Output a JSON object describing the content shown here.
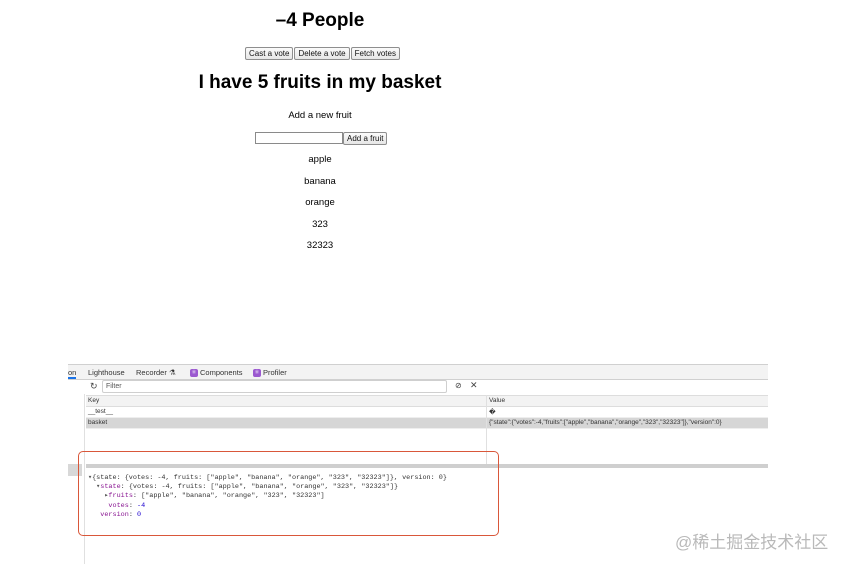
{
  "app": {
    "title": "–4 People",
    "vote_buttons": [
      "Cast a vote",
      "Delete a vote",
      "Fetch votes"
    ],
    "basket_title": "I have 5 fruits in my basket",
    "add_label": "Add a new fruit",
    "fruit_input_value": "",
    "add_button": "Add a fruit",
    "fruits": [
      "apple",
      "banana",
      "orange",
      "323",
      "32323"
    ]
  },
  "devtools": {
    "tabs": {
      "partial": "on",
      "lighthouse": "Lighthouse",
      "recorder": "Recorder",
      "recorder_icon": "⚗",
      "components": "Components",
      "profiler": "Profiler"
    },
    "filter_placeholder": "Filter",
    "table": {
      "headers": {
        "key": "Key",
        "value": "Value"
      },
      "rows": [
        {
          "key": "__test__",
          "value": "�",
          "selected": false
        },
        {
          "key": "basket",
          "value": "{\"state\":{\"votes\":-4,\"fruits\":[\"apple\",\"banana\",\"orange\",\"323\",\"32323\"]},\"version\":0}",
          "selected": true
        }
      ]
    },
    "tree": {
      "line1": "{state: {votes: -4, fruits: [\"apple\", \"banana\", \"orange\", \"323\", \"32323\"]}, version: 0}",
      "line2_key": "state",
      "line2_val": "{votes: -4, fruits: [\"apple\", \"banana\", \"orange\", \"323\", \"32323\"]}",
      "line3_key": "fruits",
      "line3_val": "[\"apple\", \"banana\", \"orange\", \"323\", \"32323\"]",
      "line4_key": "votes",
      "line4_val": "-4",
      "line5_key": "version",
      "line5_val": "0"
    }
  },
  "watermark": "@稀土掘金技术社区",
  "colors": {
    "highlight": "#d9573a",
    "link": "#1a73e8",
    "badge": "#9b59d0"
  }
}
